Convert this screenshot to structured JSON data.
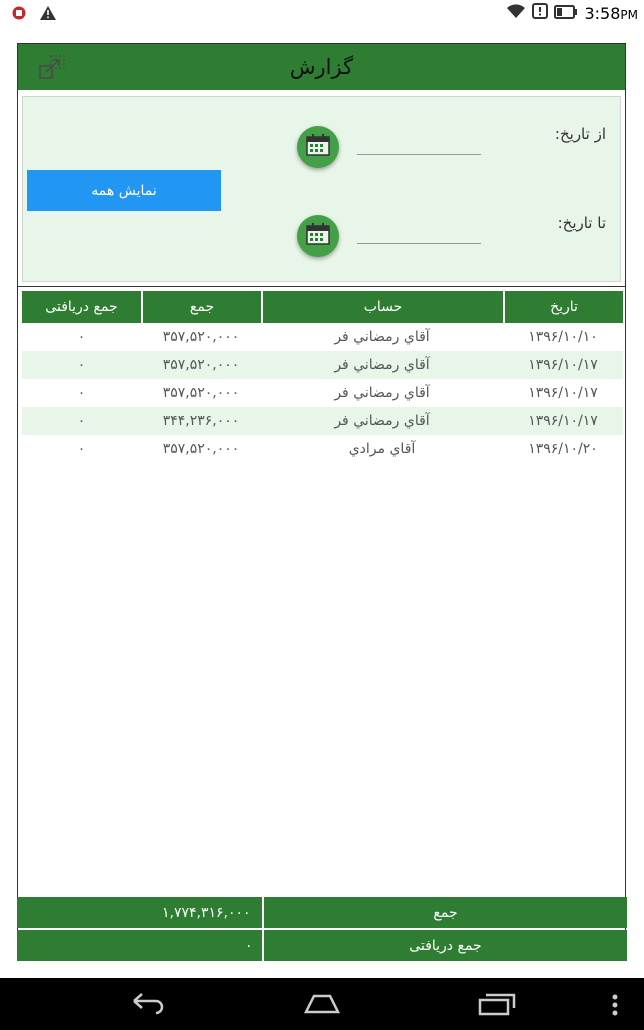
{
  "status": {
    "time": "3:58",
    "ampm": "PM"
  },
  "app": {
    "title": "گزارش",
    "filter": {
      "from_label": "از تاریخ:",
      "to_label": "تا تاریخ:",
      "from_value": "",
      "to_value": "",
      "show_all_label": "نمایش همه"
    },
    "table": {
      "headers": {
        "date": "تاریخ",
        "account": "حساب",
        "total": "جمع",
        "received": "جمع دریافتی"
      },
      "rows": [
        {
          "date": "۱۳۹۶/۱۰/۱۰",
          "account": "آقاي رمضاني فر",
          "total": "۳۵۷,۵۲۰,۰۰۰",
          "received": "۰"
        },
        {
          "date": "۱۳۹۶/۱۰/۱۷",
          "account": "آقاي رمضاني فر",
          "total": "۳۵۷,۵۲۰,۰۰۰",
          "received": "۰"
        },
        {
          "date": "۱۳۹۶/۱۰/۱۷",
          "account": "آقاي رمضاني فر",
          "total": "۳۵۷,۵۲۰,۰۰۰",
          "received": "۰"
        },
        {
          "date": "۱۳۹۶/۱۰/۱۷",
          "account": "آقاي رمضاني فر",
          "total": "۳۴۴,۲۳۶,۰۰۰",
          "received": "۰"
        },
        {
          "date": "۱۳۹۶/۱۰/۲۰",
          "account": "آقاي مرادي",
          "total": "۳۵۷,۵۲۰,۰۰۰",
          "received": "۰"
        }
      ]
    },
    "footer": {
      "total_label": "جمع",
      "total_value": "۱,۷۷۴,۳۱۶,۰۰۰",
      "received_label": "جمع دریافتی",
      "received_value": "۰"
    }
  },
  "colors": {
    "primary": "#2e7d32",
    "row_alt": "#e8f5e9",
    "button": "#2196f3",
    "calendar": "#43a047"
  }
}
